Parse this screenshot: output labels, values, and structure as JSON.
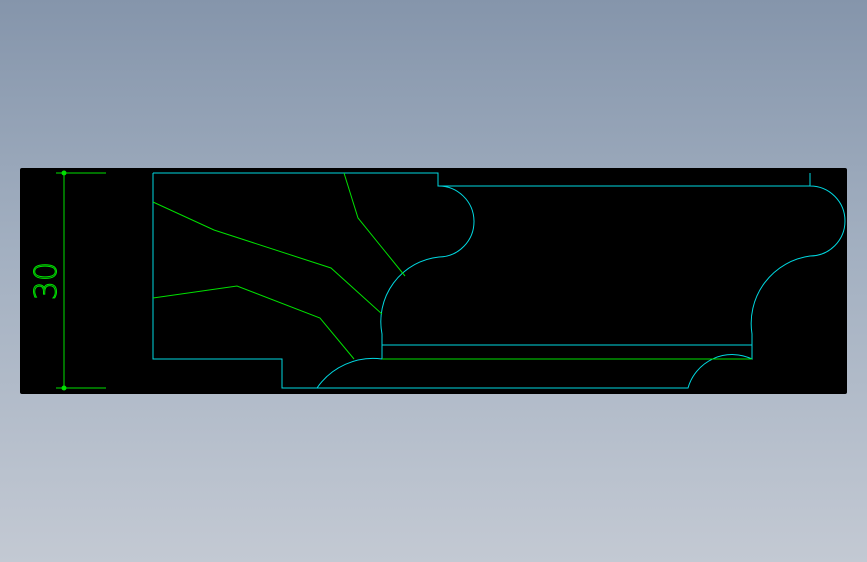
{
  "colors": {
    "background_top": "#8595ab",
    "background_bottom": "#c3c9d3",
    "canvas": "#000000",
    "profile_line": "#00d8e0",
    "hatch_line": "#00e000",
    "dimension": "#00e000"
  },
  "dimension": {
    "label": "30",
    "orientation": "vertical"
  }
}
